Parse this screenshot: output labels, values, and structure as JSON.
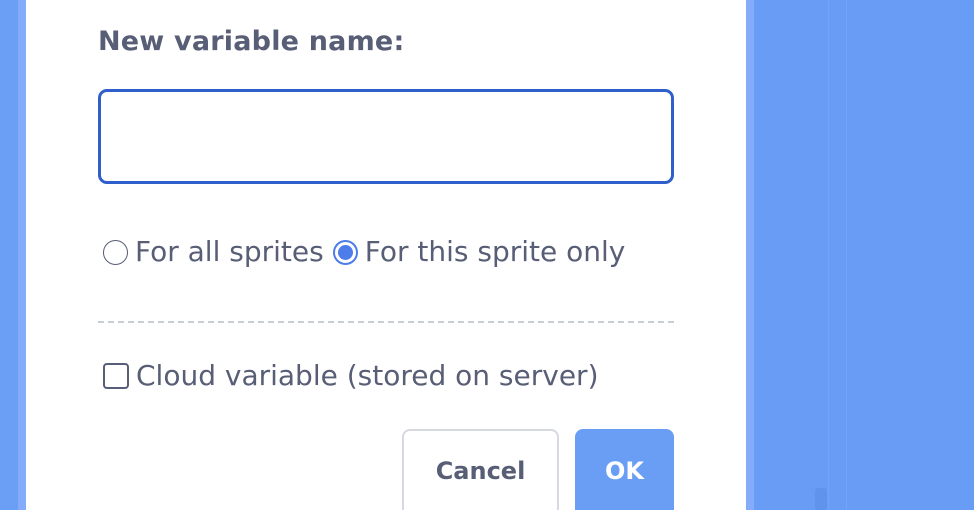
{
  "dialog": {
    "name_label": "New variable name:",
    "name_input": {
      "value": "",
      "placeholder": ""
    },
    "scope_options": [
      {
        "label": "For all sprites",
        "selected": false
      },
      {
        "label": "For this sprite only",
        "selected": true
      }
    ],
    "cloud_option": {
      "label": "Cloud variable (stored on server)",
      "checked": false
    },
    "buttons": {
      "cancel_label": "Cancel",
      "ok_label": "OK"
    }
  },
  "colors": {
    "accent": "#4c7dea",
    "input_border": "#2f5fcb",
    "text": "#575e75",
    "ok_button": "#6a9ef5",
    "background": "#6a9ef5"
  }
}
